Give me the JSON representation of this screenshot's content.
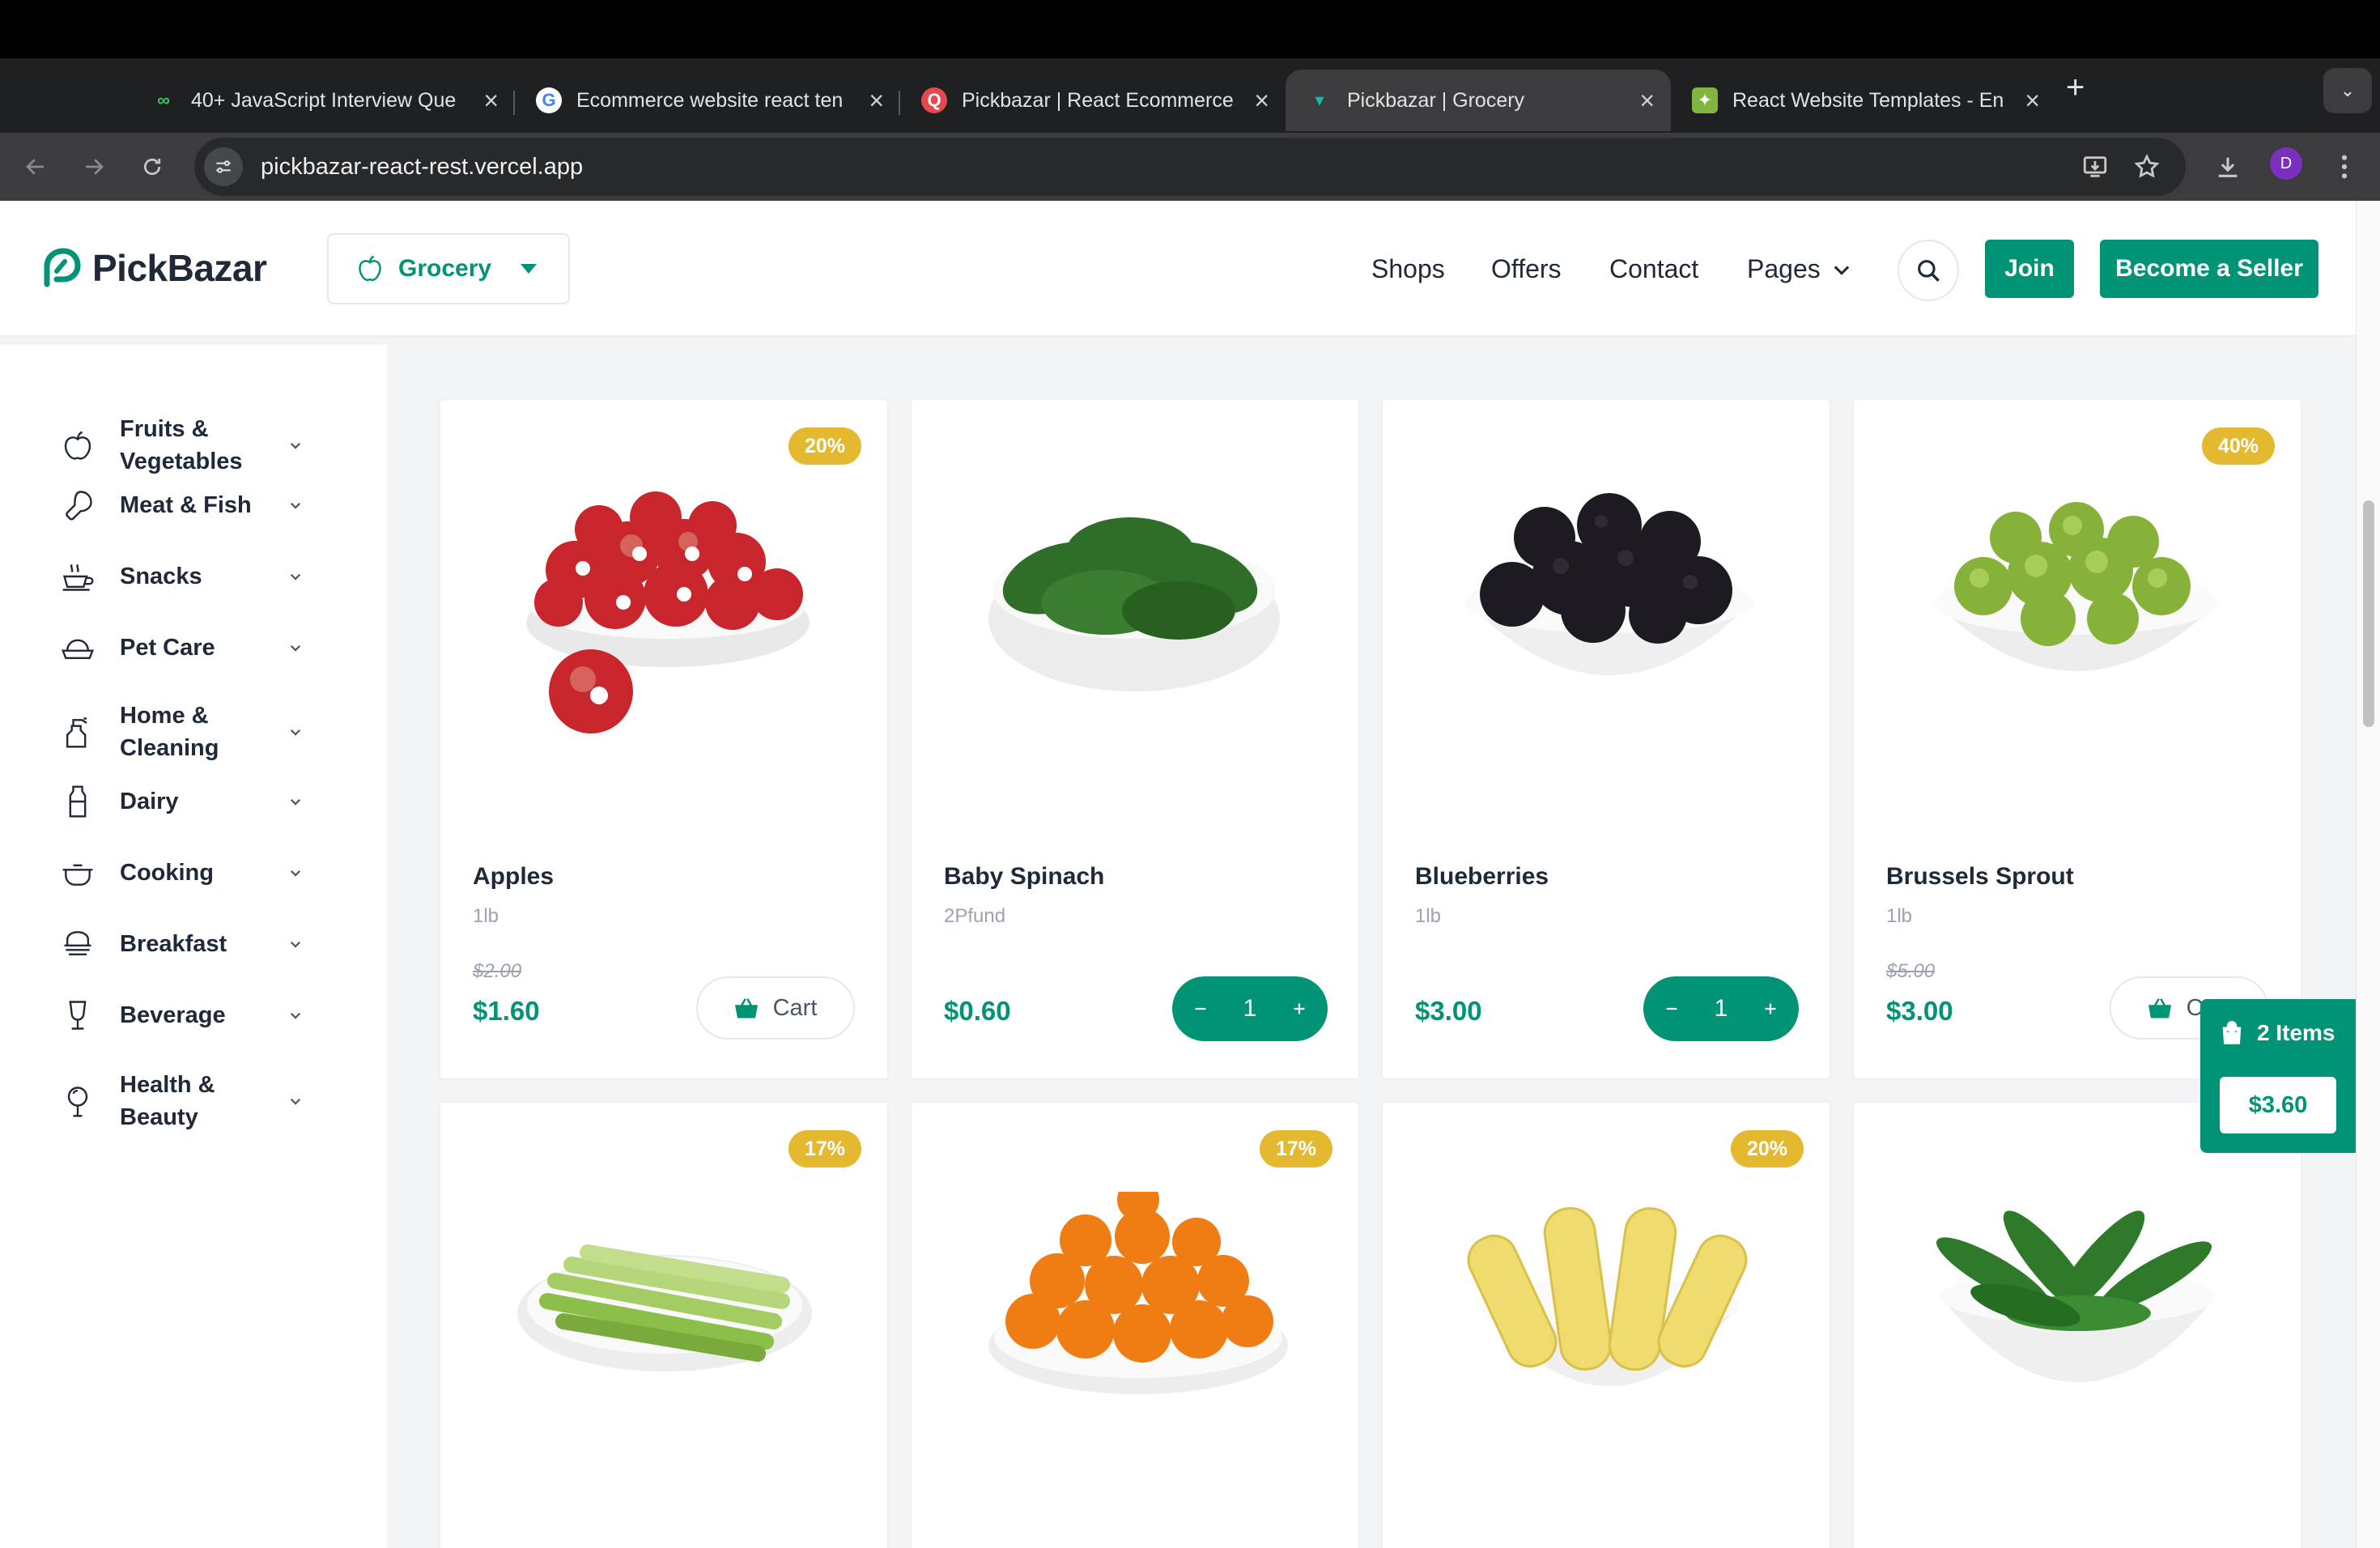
{
  "browser": {
    "tabs": [
      {
        "title": "40+ JavaScript Interview Que",
        "favicon": "codedamn-icon",
        "active": false
      },
      {
        "title": "Ecommerce website react ten",
        "favicon": "google-icon",
        "active": false
      },
      {
        "title": "Pickbazar | React Ecommerce",
        "favicon": "pickbazar-q-icon",
        "active": false
      },
      {
        "title": "Pickbazar | Grocery",
        "favicon": "pickbazar-icon",
        "active": true
      },
      {
        "title": "React Website Templates - En",
        "favicon": "envato-icon",
        "active": false
      }
    ],
    "url": "pickbazar-react-rest.vercel.app",
    "profile_initial": "D"
  },
  "header": {
    "logo_text": "PickBazar",
    "shop_selector": "Grocery",
    "nav": {
      "shops": "Shops",
      "offers": "Offers",
      "contact": "Contact",
      "pages": "Pages"
    },
    "join_label": "Join",
    "seller_label": "Become a Seller"
  },
  "categories": [
    {
      "label": "Fruits & Vegetables",
      "icon": "apple-icon"
    },
    {
      "label": "Meat & Fish",
      "icon": "drumstick-icon"
    },
    {
      "label": "Snacks",
      "icon": "snack-cup-icon"
    },
    {
      "label": "Pet Care",
      "icon": "pet-bowl-icon"
    },
    {
      "label": "Home & Cleaning",
      "icon": "spray-bottle-icon"
    },
    {
      "label": "Dairy",
      "icon": "milk-bottle-icon"
    },
    {
      "label": "Cooking",
      "icon": "cooking-pot-icon"
    },
    {
      "label": "Breakfast",
      "icon": "breakfast-bowl-icon"
    },
    {
      "label": "Beverage",
      "icon": "glass-icon"
    },
    {
      "label": "Health & Beauty",
      "icon": "beauty-mirror-icon"
    }
  ],
  "products": [
    {
      "name": "Apples",
      "unit": "1lb",
      "old_price": "$2.00",
      "price": "$1.60",
      "discount": "20%",
      "action": "cart",
      "cart_label": "Cart"
    },
    {
      "name": "Baby Spinach",
      "unit": "2Pfund",
      "old_price": "",
      "price": "$0.60",
      "discount": "",
      "action": "qty",
      "qty": "1"
    },
    {
      "name": "Blueberries",
      "unit": "1lb",
      "old_price": "",
      "price": "$3.00",
      "discount": "",
      "action": "qty",
      "qty": "1"
    },
    {
      "name": "Brussels Sprout",
      "unit": "1lb",
      "old_price": "$5.00",
      "price": "$3.00",
      "discount": "40%",
      "action": "cart",
      "cart_label": "Cart"
    },
    {
      "name": "",
      "unit": "",
      "old_price": "",
      "price": "",
      "discount": "17%"
    },
    {
      "name": "",
      "unit": "",
      "old_price": "",
      "price": "",
      "discount": "17%"
    },
    {
      "name": "",
      "unit": "",
      "old_price": "",
      "price": "",
      "discount": "20%"
    },
    {
      "name": "",
      "unit": "",
      "old_price": "",
      "price": "",
      "discount": ""
    }
  ],
  "floating_cart": {
    "items": "2 Items",
    "total": "$3.60"
  },
  "colors": {
    "accent": "#019376",
    "badge": "#e4b92f",
    "background": "#f3f4f6"
  }
}
